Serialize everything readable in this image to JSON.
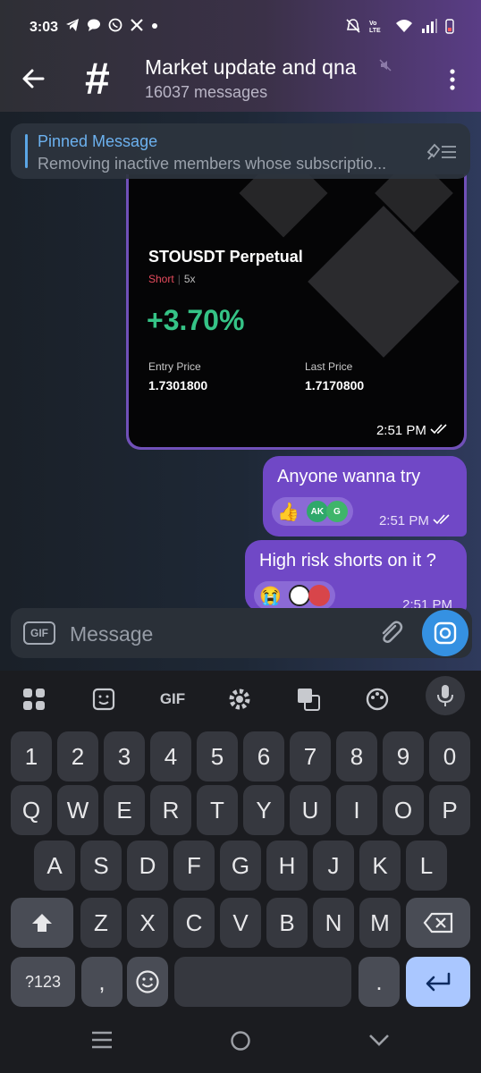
{
  "status_bar": {
    "time": "3:03"
  },
  "header": {
    "title": "Market update and qna",
    "subtitle": "16037 messages",
    "avatar_symbol": "#"
  },
  "pinned": {
    "label": "Pinned Message",
    "text": "Removing inactive members whose subscriptio..."
  },
  "card": {
    "pair": "STOUSDT Perpetual",
    "side": "Short",
    "leverage": "5x",
    "pnl": "+3.70%",
    "entry_label": "Entry Price",
    "entry_value": "1.7301800",
    "last_label": "Last Price",
    "last_value": "1.7170800",
    "time": "2:51 PM"
  },
  "messages": [
    {
      "text": "Anyone wanna try",
      "time": "2:51 PM",
      "reaction": "👍",
      "reactors": [
        "AK",
        "G"
      ]
    },
    {
      "text": "High risk shorts on it ?",
      "time": "2:51 PM",
      "reaction": "😭"
    }
  ],
  "input": {
    "placeholder": "Message",
    "gif_label": "GIF"
  },
  "keyboard": {
    "gif_label": "GIF",
    "numbers": [
      "1",
      "2",
      "3",
      "4",
      "5",
      "6",
      "7",
      "8",
      "9",
      "0"
    ],
    "row1": [
      "Q",
      "W",
      "E",
      "R",
      "T",
      "Y",
      "U",
      "I",
      "O",
      "P"
    ],
    "row2": [
      "A",
      "S",
      "D",
      "F",
      "G",
      "H",
      "J",
      "K",
      "L"
    ],
    "row3": [
      "Z",
      "X",
      "C",
      "V",
      "B",
      "N",
      "M"
    ],
    "symbols_label": "?123",
    "comma": ",",
    "period": "."
  },
  "colors": {
    "accent": "#7048c6",
    "link": "#6cb1ef",
    "profit": "#35c386",
    "short": "#e74b5d",
    "camera": "#3591e2"
  }
}
